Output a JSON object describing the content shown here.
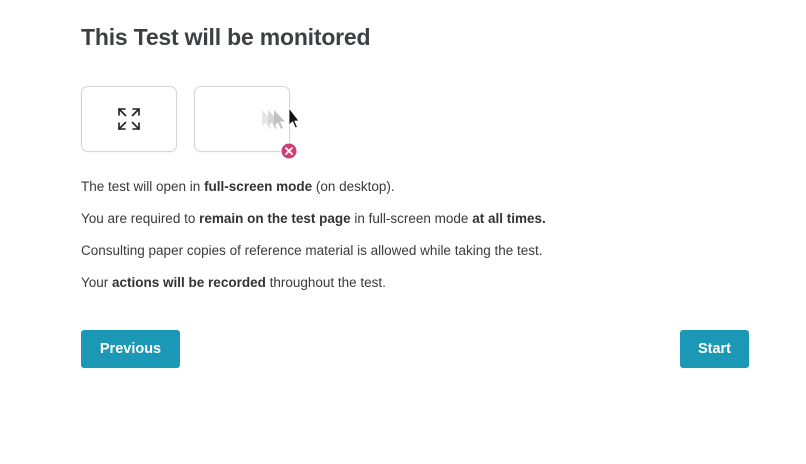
{
  "title": "This Test will be monitored",
  "icons": {
    "fullscreen": "expand-arrows-icon",
    "leave_page": "cursor-leaving-icon",
    "not_allowed": "close-circle-icon"
  },
  "rules": [
    {
      "t1": "The test will open in ",
      "b1": "full-screen mode",
      "t2": " (on desktop).",
      "b2": "",
      "t3": ""
    },
    {
      "t1": "You are required to ",
      "b1": "remain on the test page",
      "t2": " in full-screen mode ",
      "b2": "at all times.",
      "t3": ""
    },
    {
      "t1": "Consulting paper copies of reference material is allowed while taking the test.",
      "b1": "",
      "t2": "",
      "b2": "",
      "t3": ""
    },
    {
      "t1": "Your ",
      "b1": "actions will be recorded",
      "t2": " throughout the test.",
      "b2": "",
      "t3": ""
    }
  ],
  "buttons": {
    "previous": "Previous",
    "start": "Start"
  },
  "colors": {
    "primary": "#1b98b5",
    "danger_badge": "#cf3d74",
    "title": "#3d3f44"
  }
}
